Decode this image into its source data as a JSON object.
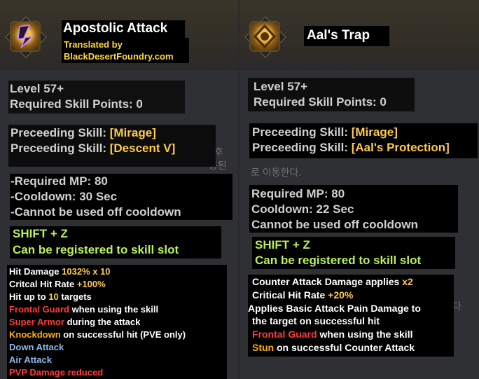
{
  "left": {
    "title": "Apostolic Attack",
    "credit": [
      "Translated by",
      "BlackDesertFoundry.com"
    ],
    "level": "Level 57+",
    "skill_points": "Required Skill Points: 0",
    "preceding_label": "Preceeding Skill: ",
    "preceding": [
      "[Mirage]",
      "[Descent V]"
    ],
    "mp": "-Required MP: 80",
    "cooldown": "-Cooldown: 30 Sec",
    "cannot": "-Cannot be used off cooldown",
    "keys": "SHIFT + Z",
    "registerable": "Can be registered to skill slot",
    "effects": {
      "hit_damage": [
        "Hit Damage ",
        "1032% x 10"
      ],
      "crit": [
        "Critcal Hit Rate ",
        "+100%"
      ],
      "targets": [
        "Hit up to ",
        "10",
        " targets"
      ],
      "frontal": [
        "Frontal Guard",
        " when using the skill"
      ],
      "super_armor": [
        "Super Armor",
        " during the attack"
      ],
      "knockdown": [
        "Knockdown",
        " on successful hit (PVE only)"
      ],
      "down_attack": "Down Attack",
      "air_attack": "Air Attack",
      "pvp": "PVP Damage reduced"
    },
    "ghost": [
      "후",
      "용된다."
    ]
  },
  "right": {
    "title": "Aal's Trap",
    "level": "Level 57+",
    "skill_points": "Required Skill Points: 0",
    "preceding_label": "Preceeding Skill: ",
    "preceding": [
      "[Mirage]",
      "[Aal's Protection]"
    ],
    "mp": "Required MP: 80",
    "cooldown": "Cooldown: 22 Sec",
    "cannot": "Cannot be used off cooldown",
    "keys": "SHIFT + Z",
    "registerable": "Can be registered to skill slot",
    "effects": {
      "counter": [
        "Counter Attack Damage applies ",
        "x2"
      ],
      "crit": [
        "Critical Hit Rate ",
        "+20%"
      ],
      "pain1": "Applies Basic Attack Pain Damage to",
      "pain2": "the target on successful hit",
      "frontal": [
        "Frontal Guard",
        " when using the skill"
      ],
      "stun": [
        "Stun",
        " on successful Counter Attack"
      ]
    },
    "ghost": [
      "로 이동한다.",
      "다"
    ]
  }
}
